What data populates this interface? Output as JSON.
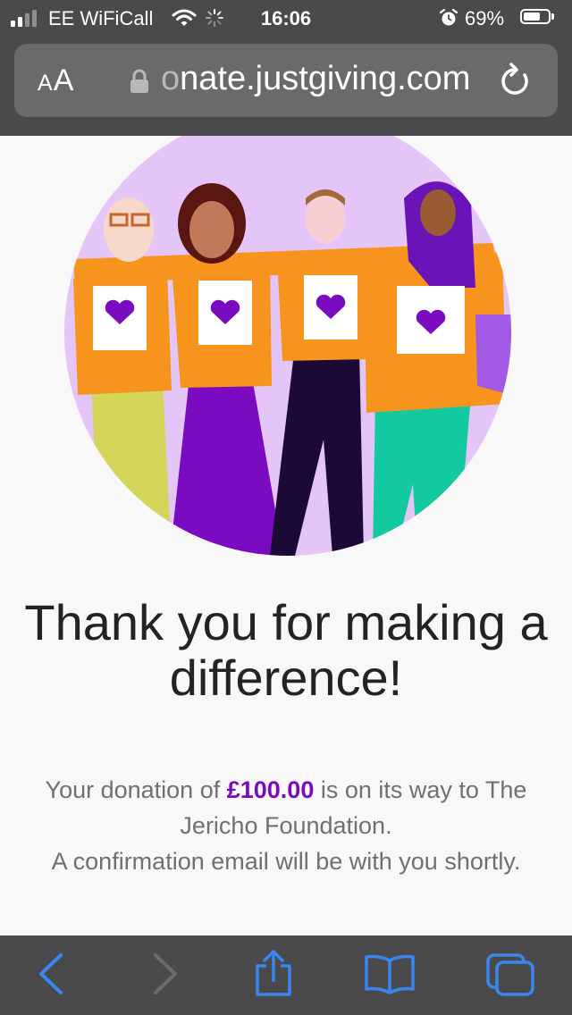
{
  "status_bar": {
    "carrier": "EE WiFiCall",
    "time": "16:06",
    "battery_percent": "69%",
    "battery_level": 0.69,
    "icons": [
      "signal-icon",
      "wifi-icon",
      "loading-spinner-icon",
      "alarm-icon",
      "battery-icon"
    ]
  },
  "browser": {
    "text_size_label": "AA",
    "url_faded": "o",
    "url": "nate.justgiving.com",
    "icons": [
      "lock-icon",
      "reload-icon"
    ]
  },
  "page": {
    "headline": "Thank you for making a difference!",
    "message": {
      "prefix": "Your donation of ",
      "amount": "£100.00",
      "suffix": " is on its way to The Jericho Foundation.",
      "line2": "A confirmation email will be with you shortly."
    },
    "accent_color": "#7a0bc0",
    "illustration_colors": {
      "circle": "#e3c6f7",
      "shirt": "#f7941d",
      "heart": "#7a0bc0"
    }
  },
  "toolbar": {
    "icons": [
      "back-icon",
      "forward-icon",
      "share-icon",
      "bookmarks-icon",
      "tabs-icon"
    ],
    "accent_color": "#3a86f0"
  }
}
